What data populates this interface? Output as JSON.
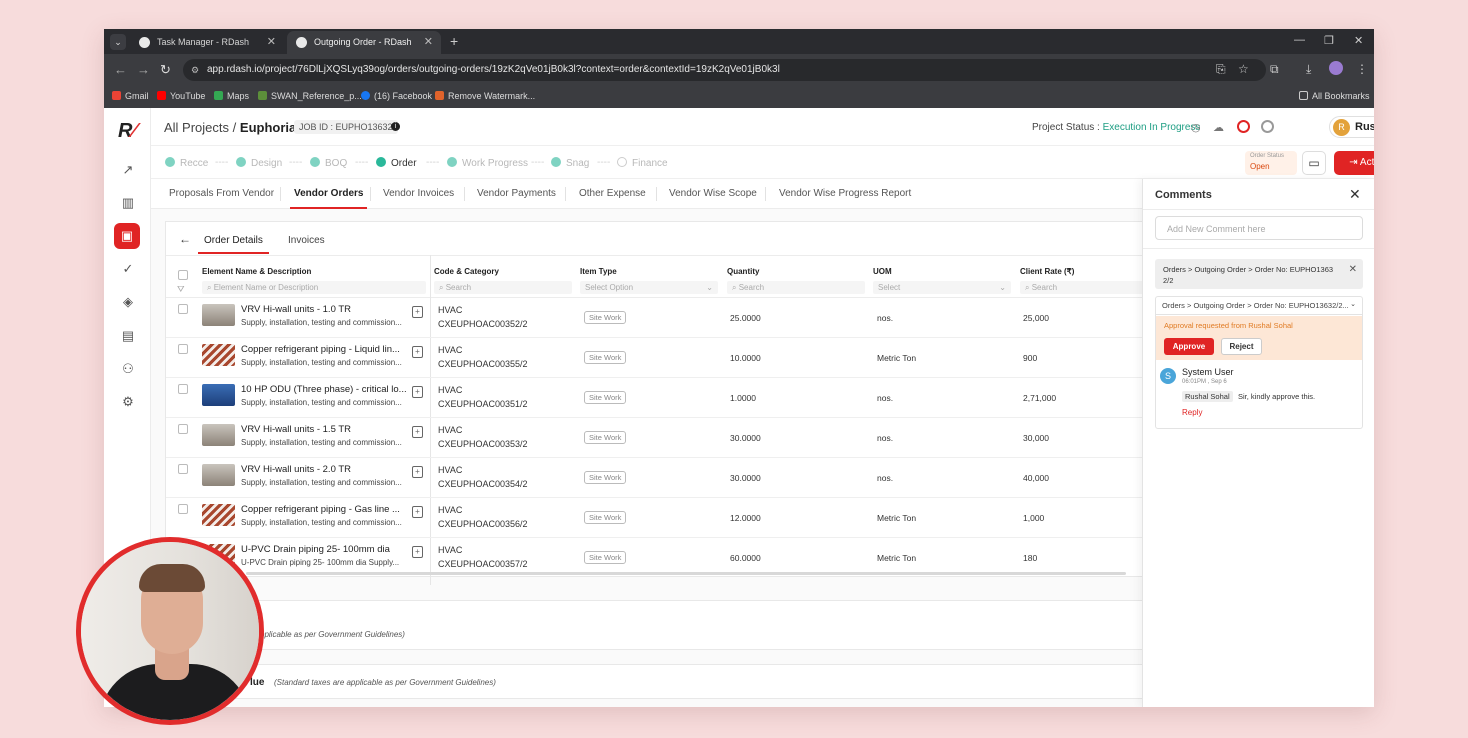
{
  "browser": {
    "tabs": [
      {
        "title": "Task Manager - RDash"
      },
      {
        "title": "Outgoing Order - RDash"
      }
    ],
    "url": "app.rdash.io/project/76DlLjXQSLyq39og/orders/outgoing-orders/19zK2qVe01jB0k3l?context=order&contextId=19zK2qVe01jB0k3l",
    "bookmarks": [
      "Gmail",
      "YouTube",
      "Maps",
      "SWAN_Reference_p...",
      "(16) Facebook",
      "Remove Watermark...",
      "All Bookmarks"
    ]
  },
  "header": {
    "breadcrumb_root": "All Projects",
    "breadcrumb_sep": "/",
    "project": "Euphoria",
    "job_id": "JOB ID : EUPHO13632",
    "status_label": "Project Status :",
    "status_value": "Execution In Progress",
    "user": {
      "initial": "R",
      "name": "Rushal"
    }
  },
  "stages": [
    "Recce",
    "Design",
    "BOQ",
    "Order",
    "Work Progress",
    "Snag",
    "Finance"
  ],
  "order_status": {
    "label": "Order Status",
    "value": "Open"
  },
  "actions_label": "Actions",
  "subtabs": [
    "Proposals From Vendor",
    "Vendor Orders",
    "Vendor Invoices",
    "Vendor Payments",
    "Other Expense",
    "Vendor Wise Scope",
    "Vendor Wise Progress Report"
  ],
  "inner_tabs": [
    "Order Details",
    "Invoices"
  ],
  "table": {
    "columns": [
      "Element Name & Description",
      "Code & Category",
      "Item Type",
      "Quantity",
      "UOM",
      "Client Rate (₹)"
    ],
    "filters": [
      "Element Name or Description",
      "Search",
      "Select Option",
      "Search",
      "Select",
      "Search"
    ],
    "rows": [
      {
        "name": "VRV Hi-wall units - 1.0 TR",
        "desc": "Supply, installation, testing and commission...",
        "category": "HVAC",
        "code": "CXEUPHOAC00352/2",
        "type": "Site Work",
        "qty": "25.0000",
        "uom": "nos.",
        "rate": "25,000"
      },
      {
        "name": "Copper refrigerant piping - Liquid lin...",
        "desc": "Supply, installation, testing and commission...",
        "category": "HVAC",
        "code": "CXEUPHOAC00355/2",
        "type": "Site Work",
        "qty": "10.0000",
        "uom": "Metric Ton",
        "rate": "900"
      },
      {
        "name": "10 HP ODU (Three phase) - critical lo...",
        "desc": "Supply, installation, testing and commission...",
        "category": "HVAC",
        "code": "CXEUPHOAC00351/2",
        "type": "Site Work",
        "qty": "1.0000",
        "uom": "nos.",
        "rate": "2,71,000"
      },
      {
        "name": "VRV Hi-wall units - 1.5 TR",
        "desc": "Supply, installation, testing and commission...",
        "category": "HVAC",
        "code": "CXEUPHOAC00353/2",
        "type": "Site Work",
        "qty": "30.0000",
        "uom": "nos.",
        "rate": "30,000"
      },
      {
        "name": "VRV Hi-wall units - 2.0 TR",
        "desc": "Supply, installation, testing and commission...",
        "category": "HVAC",
        "code": "CXEUPHOAC00354/2",
        "type": "Site Work",
        "qty": "30.0000",
        "uom": "nos.",
        "rate": "40,000"
      },
      {
        "name": "Copper refrigerant piping - Gas line ...",
        "desc": "Supply, installation, testing and commission...",
        "category": "HVAC",
        "code": "CXEUPHOAC00356/2",
        "type": "Site Work",
        "qty": "12.0000",
        "uom": "Metric Ton",
        "rate": "1,000"
      },
      {
        "name": "U-PVC Drain piping 25- 100mm dia",
        "desc": "U-PVC Drain piping 25- 100mm dia Supply...",
        "category": "HVAC",
        "code": "CXEUPHOAC00357/2",
        "type": "Site Work",
        "qty": "60.0000",
        "uom": "Metric Ton",
        "rate": "180"
      }
    ]
  },
  "lower_notes": {
    "n1": "pplicable as per Government Guidelines)",
    "n2_label": "lue",
    "n2": "(Standard taxes are applicable as per Government Guidelines)"
  },
  "comments": {
    "title": "Comments",
    "placeholder": "Add New Comment here",
    "context": "Orders > Outgoing Order > Order No: EUPHO1363 2/2",
    "thread_select": "Orders > Outgoing Order > Order No: EUPHO13632/2...",
    "approval_text": "Approval requested from Rushal Sohal",
    "approve": "Approve",
    "reject": "Reject",
    "user_initial": "S",
    "user": "System User",
    "time": "06:01PM , Sep 6",
    "mention": "Rushal Sohal",
    "message": "Sir, kindly approve this.",
    "reply": "Reply"
  },
  "colors": {
    "accent": "#e02424",
    "stage": "#2ab89a",
    "status": "#1e9e83"
  }
}
